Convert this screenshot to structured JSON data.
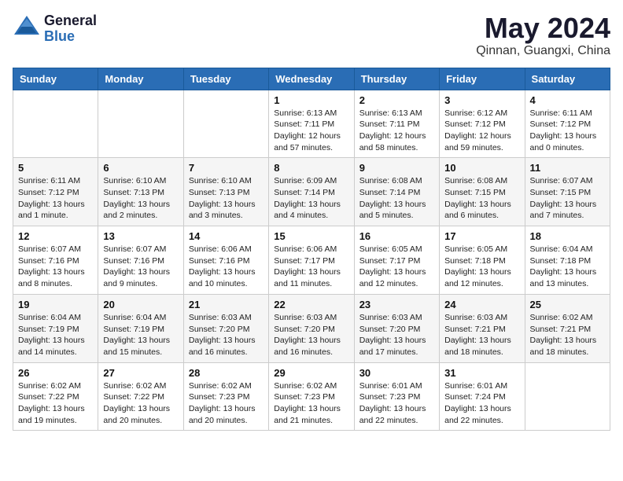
{
  "header": {
    "logo_general": "General",
    "logo_blue": "Blue",
    "title": "May 2024",
    "subtitle": "Qinnan, Guangxi, China"
  },
  "weekdays": [
    "Sunday",
    "Monday",
    "Tuesday",
    "Wednesday",
    "Thursday",
    "Friday",
    "Saturday"
  ],
  "weeks": [
    [
      {
        "day": "",
        "info": ""
      },
      {
        "day": "",
        "info": ""
      },
      {
        "day": "",
        "info": ""
      },
      {
        "day": "1",
        "info": "Sunrise: 6:13 AM\nSunset: 7:11 PM\nDaylight: 12 hours and 57 minutes."
      },
      {
        "day": "2",
        "info": "Sunrise: 6:13 AM\nSunset: 7:11 PM\nDaylight: 12 hours and 58 minutes."
      },
      {
        "day": "3",
        "info": "Sunrise: 6:12 AM\nSunset: 7:12 PM\nDaylight: 12 hours and 59 minutes."
      },
      {
        "day": "4",
        "info": "Sunrise: 6:11 AM\nSunset: 7:12 PM\nDaylight: 13 hours and 0 minutes."
      }
    ],
    [
      {
        "day": "5",
        "info": "Sunrise: 6:11 AM\nSunset: 7:12 PM\nDaylight: 13 hours and 1 minute."
      },
      {
        "day": "6",
        "info": "Sunrise: 6:10 AM\nSunset: 7:13 PM\nDaylight: 13 hours and 2 minutes."
      },
      {
        "day": "7",
        "info": "Sunrise: 6:10 AM\nSunset: 7:13 PM\nDaylight: 13 hours and 3 minutes."
      },
      {
        "day": "8",
        "info": "Sunrise: 6:09 AM\nSunset: 7:14 PM\nDaylight: 13 hours and 4 minutes."
      },
      {
        "day": "9",
        "info": "Sunrise: 6:08 AM\nSunset: 7:14 PM\nDaylight: 13 hours and 5 minutes."
      },
      {
        "day": "10",
        "info": "Sunrise: 6:08 AM\nSunset: 7:15 PM\nDaylight: 13 hours and 6 minutes."
      },
      {
        "day": "11",
        "info": "Sunrise: 6:07 AM\nSunset: 7:15 PM\nDaylight: 13 hours and 7 minutes."
      }
    ],
    [
      {
        "day": "12",
        "info": "Sunrise: 6:07 AM\nSunset: 7:16 PM\nDaylight: 13 hours and 8 minutes."
      },
      {
        "day": "13",
        "info": "Sunrise: 6:07 AM\nSunset: 7:16 PM\nDaylight: 13 hours and 9 minutes."
      },
      {
        "day": "14",
        "info": "Sunrise: 6:06 AM\nSunset: 7:16 PM\nDaylight: 13 hours and 10 minutes."
      },
      {
        "day": "15",
        "info": "Sunrise: 6:06 AM\nSunset: 7:17 PM\nDaylight: 13 hours and 11 minutes."
      },
      {
        "day": "16",
        "info": "Sunrise: 6:05 AM\nSunset: 7:17 PM\nDaylight: 13 hours and 12 minutes."
      },
      {
        "day": "17",
        "info": "Sunrise: 6:05 AM\nSunset: 7:18 PM\nDaylight: 13 hours and 12 minutes."
      },
      {
        "day": "18",
        "info": "Sunrise: 6:04 AM\nSunset: 7:18 PM\nDaylight: 13 hours and 13 minutes."
      }
    ],
    [
      {
        "day": "19",
        "info": "Sunrise: 6:04 AM\nSunset: 7:19 PM\nDaylight: 13 hours and 14 minutes."
      },
      {
        "day": "20",
        "info": "Sunrise: 6:04 AM\nSunset: 7:19 PM\nDaylight: 13 hours and 15 minutes."
      },
      {
        "day": "21",
        "info": "Sunrise: 6:03 AM\nSunset: 7:20 PM\nDaylight: 13 hours and 16 minutes."
      },
      {
        "day": "22",
        "info": "Sunrise: 6:03 AM\nSunset: 7:20 PM\nDaylight: 13 hours and 16 minutes."
      },
      {
        "day": "23",
        "info": "Sunrise: 6:03 AM\nSunset: 7:20 PM\nDaylight: 13 hours and 17 minutes."
      },
      {
        "day": "24",
        "info": "Sunrise: 6:03 AM\nSunset: 7:21 PM\nDaylight: 13 hours and 18 minutes."
      },
      {
        "day": "25",
        "info": "Sunrise: 6:02 AM\nSunset: 7:21 PM\nDaylight: 13 hours and 18 minutes."
      }
    ],
    [
      {
        "day": "26",
        "info": "Sunrise: 6:02 AM\nSunset: 7:22 PM\nDaylight: 13 hours and 19 minutes."
      },
      {
        "day": "27",
        "info": "Sunrise: 6:02 AM\nSunset: 7:22 PM\nDaylight: 13 hours and 20 minutes."
      },
      {
        "day": "28",
        "info": "Sunrise: 6:02 AM\nSunset: 7:23 PM\nDaylight: 13 hours and 20 minutes."
      },
      {
        "day": "29",
        "info": "Sunrise: 6:02 AM\nSunset: 7:23 PM\nDaylight: 13 hours and 21 minutes."
      },
      {
        "day": "30",
        "info": "Sunrise: 6:01 AM\nSunset: 7:23 PM\nDaylight: 13 hours and 22 minutes."
      },
      {
        "day": "31",
        "info": "Sunrise: 6:01 AM\nSunset: 7:24 PM\nDaylight: 13 hours and 22 minutes."
      },
      {
        "day": "",
        "info": ""
      }
    ]
  ]
}
